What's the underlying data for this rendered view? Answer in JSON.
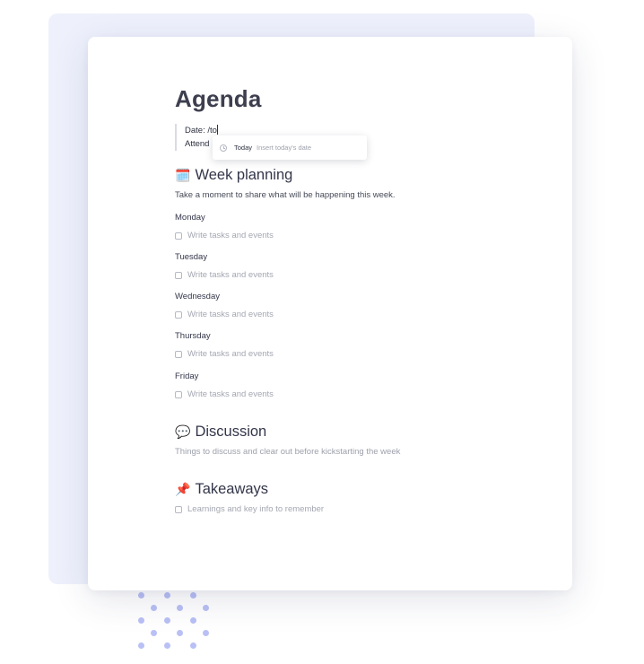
{
  "doc": {
    "title": "Agenda",
    "meta": {
      "date_label": "Date: /to",
      "attendees_label": "Attend"
    },
    "popup": {
      "icon": "clock-icon",
      "label": "Today",
      "description": "Insert today's date"
    },
    "week": {
      "emoji": "🗓️",
      "heading": "Week planning",
      "description": "Take a moment to share what will be happening this week.",
      "days": [
        {
          "name": "Monday",
          "task": "Write tasks and events"
        },
        {
          "name": "Tuesday",
          "task": "Write tasks and events"
        },
        {
          "name": "Wednesday",
          "task": "Write tasks and events"
        },
        {
          "name": "Thursday",
          "task": "Write tasks and events"
        },
        {
          "name": "Friday",
          "task": "Write tasks and events"
        }
      ]
    },
    "discussion": {
      "emoji": "💬",
      "heading": "Discussion",
      "description": "Things to discuss and clear out before kickstarting the week"
    },
    "takeaways": {
      "emoji": "📌",
      "heading": "Takeaways",
      "task": "Learnings and key info to remember"
    }
  },
  "colors": {
    "accent_dots": "#b9c0f5",
    "background_card": "#eef1fc"
  }
}
